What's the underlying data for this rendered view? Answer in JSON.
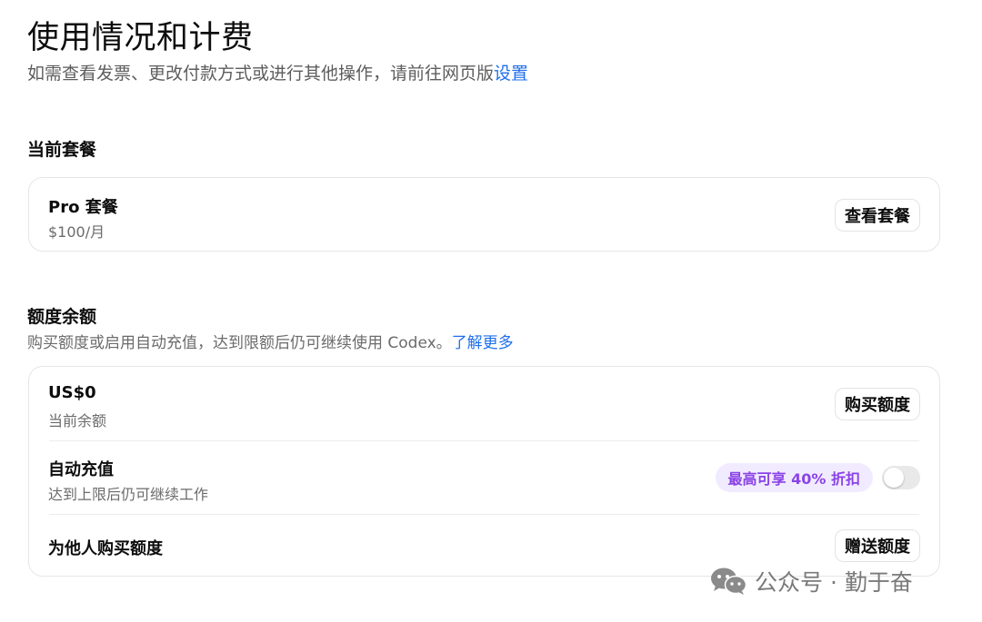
{
  "header": {
    "title": "使用情况和计费",
    "subtitle_prefix": "如需查看发票、更改付款方式或进行其他操作，请前往网页版",
    "subtitle_link": "设置"
  },
  "current_plan": {
    "section_title": "当前套餐",
    "plan_name": "Pro 套餐",
    "plan_price": "$100/月",
    "view_button": "查看套餐"
  },
  "credits": {
    "section_title": "额度余额",
    "desc_prefix": "购买额度或启用自动充值，达到限额后仍可继续使用 Codex。",
    "desc_link": "了解更多",
    "balance": {
      "amount": "US$0",
      "label": "当前余额",
      "buy_button": "购买额度"
    },
    "auto_recharge": {
      "title": "自动充值",
      "description": "达到上限后仍可继续工作",
      "badge": "最高可享 40% 折扣",
      "enabled": false
    },
    "gift": {
      "title": "为他人购买额度",
      "button": "赠送额度"
    }
  },
  "watermark": {
    "text": "公众号 · 勤于奋",
    "icon": "wechat-icon"
  },
  "colors": {
    "link": "#1f6feb",
    "badge_bg": "#f1ebff",
    "badge_text": "#8a43e6"
  }
}
